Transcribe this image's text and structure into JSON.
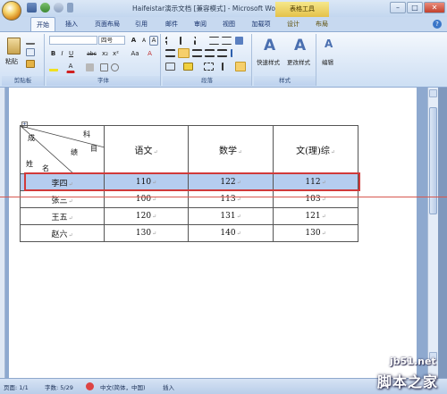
{
  "titlebar": {
    "title": "Haifeistar演示文档 [兼容模式] - Microsoft Word",
    "context_tab": "表格工具",
    "minimize": "–",
    "maximize": "□",
    "close": "✕"
  },
  "tabs": [
    "开始",
    "插入",
    "页面布局",
    "引用",
    "邮件",
    "审阅",
    "视图",
    "加载项",
    "设计",
    "布局"
  ],
  "ribbon": {
    "clipboard": {
      "label": "剪贴板",
      "paste": "粘贴"
    },
    "font": {
      "label": "字体",
      "size": "四号",
      "bold": "B",
      "italic": "I",
      "underline": "U",
      "font_color_glyph": "A",
      "grow": "A",
      "shrink": "A",
      "strike": "abc",
      "sub": "x₂",
      "sup": "x²",
      "aa": "Aa",
      "clear": "A",
      "char_border": "A"
    },
    "paragraph": {
      "label": "段落"
    },
    "styles": {
      "label": "样式",
      "quick": "快速样式",
      "change": "更改样式",
      "glyph": "A"
    },
    "editing": {
      "label": "编辑",
      "glyph": "A"
    }
  },
  "table": {
    "diagonal_header": {
      "top_left": "成",
      "top_right": "科",
      "middle": "绩",
      "right_bottom": "目",
      "bottom_left": "姓",
      "bottom_middle": "名"
    },
    "columns": [
      "语文",
      "数学",
      "文(理)综"
    ],
    "rows": [
      {
        "name": "李四",
        "scores": [
          "110",
          "122",
          "112"
        ],
        "selected": true
      },
      {
        "name": "张三",
        "scores": [
          "100",
          "113",
          "103"
        ],
        "selected": false
      },
      {
        "name": "王五",
        "scores": [
          "120",
          "131",
          "121"
        ],
        "selected": false
      },
      {
        "name": "赵六",
        "scores": [
          "130",
          "140",
          "130"
        ],
        "selected": false
      }
    ]
  },
  "statusbar": {
    "page": "页面: 1/1",
    "words": "字数: 5/29",
    "language": "中文(简体，中国)",
    "mode": "插入"
  },
  "watermark": {
    "url": "jb51.net",
    "name": "脚本之家"
  },
  "colors": {
    "highlight_border": "#d13a3a",
    "selected_row": "#b5cdef",
    "ribbon": "#dce8f7"
  }
}
